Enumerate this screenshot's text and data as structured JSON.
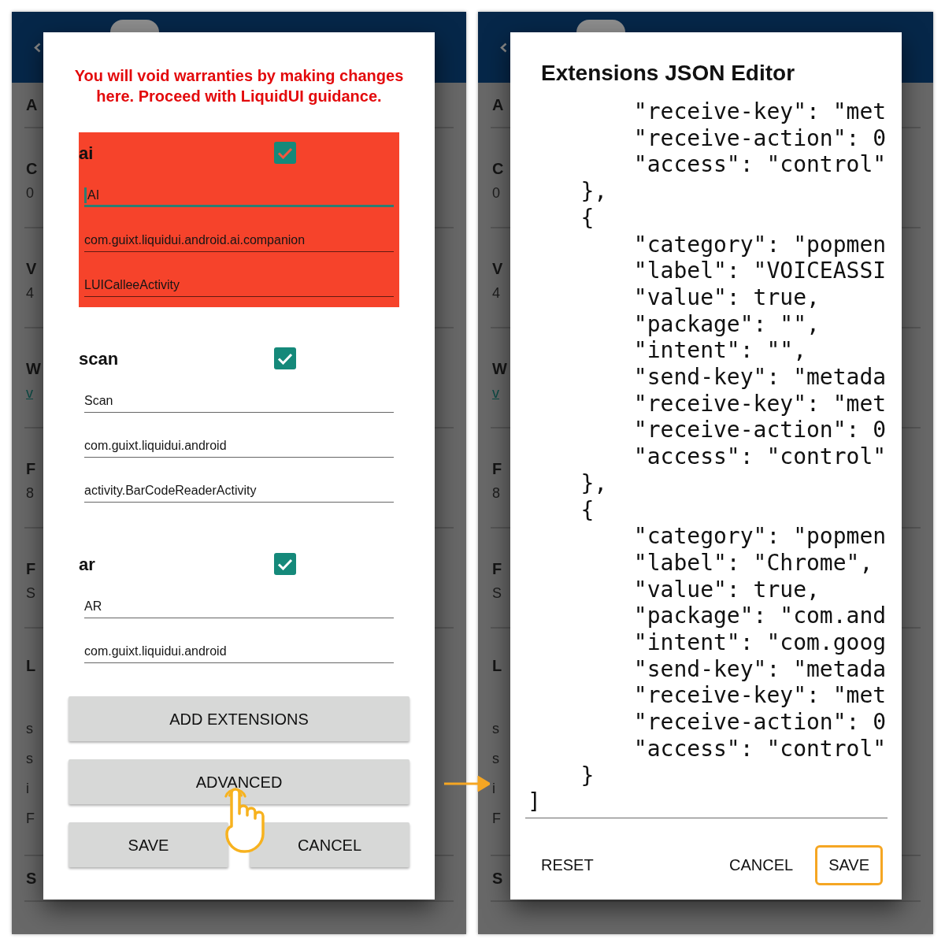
{
  "form_screen": {
    "background_rows": [
      {
        "title": "A"
      },
      {
        "title": "C",
        "subtitle": "0"
      },
      {
        "title": "V",
        "subtitle": "4"
      },
      {
        "title": "W",
        "link": "v"
      },
      {
        "title": "F",
        "subtitle": "8"
      },
      {
        "title": "F",
        "subtitle": "S"
      },
      {
        "title": "L",
        "details": [
          "s",
          "s",
          "i",
          "F"
        ]
      },
      {
        "title": "S"
      }
    ],
    "dialog": {
      "warning": "You will void warranties by making changes here. Proceed with LiquidUI guidance.",
      "extensions": [
        {
          "name": "ai",
          "checked": true,
          "highlighted": true,
          "fields": [
            {
              "value": "AI",
              "focused": true
            },
            {
              "value": "com.guixt.liquidui.android.ai.companion",
              "focused": false
            },
            {
              "value": "LUICalleeActivity",
              "focused": false
            }
          ]
        },
        {
          "name": "scan",
          "checked": true,
          "highlighted": false,
          "fields": [
            {
              "value": "Scan",
              "focused": false
            },
            {
              "value": "com.guixt.liquidui.android",
              "focused": false
            },
            {
              "value": "activity.BarCodeReaderActivity",
              "focused": false
            }
          ]
        },
        {
          "name": "ar",
          "checked": true,
          "highlighted": false,
          "fields": [
            {
              "value": "AR",
              "focused": false
            },
            {
              "value": "com.guixt.liquidui.android",
              "focused": false
            }
          ]
        }
      ],
      "buttons": [
        {
          "label": "ADD EXTENSIONS",
          "tapped": false
        },
        {
          "label": "ADVANCED",
          "tapped": true
        }
      ],
      "footer_buttons": [
        {
          "label": "SAVE"
        },
        {
          "label": "CANCEL"
        }
      ]
    }
  },
  "editor_screen": {
    "background_rows": [
      {
        "title": "A"
      },
      {
        "title": "C",
        "subtitle": "0"
      },
      {
        "title": "V",
        "subtitle": "4"
      },
      {
        "title": "W",
        "link": "v"
      },
      {
        "title": "F",
        "subtitle": "8"
      },
      {
        "title": "F",
        "subtitle": "S"
      },
      {
        "title": "L",
        "details": [
          "s",
          "s",
          "i",
          "F"
        ]
      },
      {
        "title": "S"
      }
    ],
    "dialog": {
      "title": "Extensions JSON Editor",
      "lines": [
        "        \"receive-key\": \"met",
        "        \"receive-action\": 0",
        "        \"access\": \"control\"",
        "    },",
        "    {",
        "        \"category\": \"popmen",
        "        \"label\": \"VOICEASSI",
        "        \"value\": true,",
        "        \"package\": \"\",",
        "        \"intent\": \"\",",
        "        \"send-key\": \"metada",
        "        \"receive-key\": \"met",
        "        \"receive-action\": 0",
        "        \"access\": \"control\"",
        "    },",
        "    {",
        "        \"category\": \"popmen",
        "        \"label\": \"Chrome\",",
        "        \"value\": true,",
        "        \"package\": \"com.and",
        "        \"intent\": \"com.goog",
        "        \"send-key\": \"metada",
        "        \"receive-key\": \"met",
        "        \"receive-action\": 0",
        "        \"access\": \"control\"",
        "    }",
        "]"
      ],
      "buttons": [
        {
          "label": "RESET",
          "highlighted": false
        },
        {
          "label": "CANCEL",
          "highlighted": false
        },
        {
          "label": "SAVE",
          "highlighted": true
        }
      ]
    }
  }
}
